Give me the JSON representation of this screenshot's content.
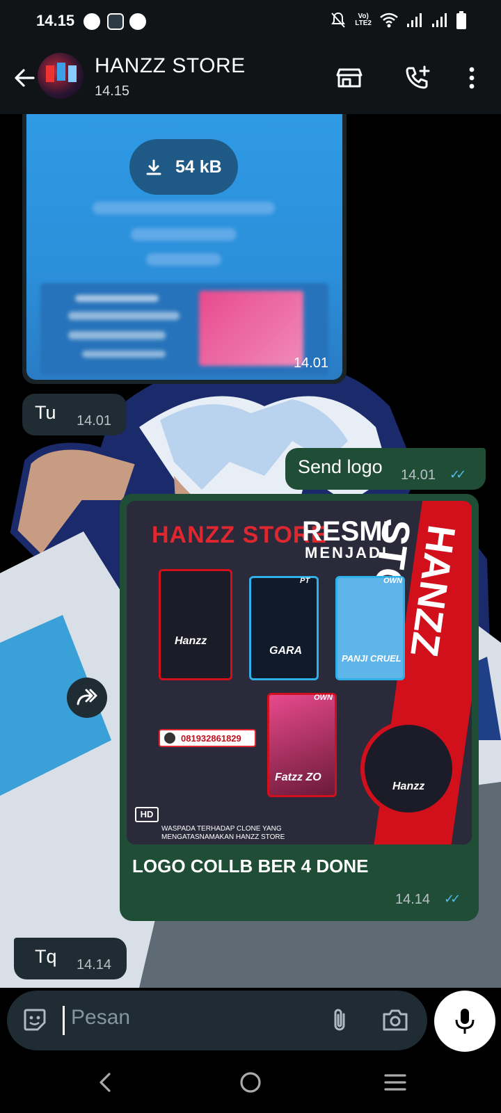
{
  "status_bar": {
    "time": "14.15",
    "network_label": "LTE2"
  },
  "header": {
    "title": "HANZZ STORE",
    "subtitle": "14.15"
  },
  "messages": {
    "receipt": {
      "download_size": "54 kB",
      "time": "14.01"
    },
    "tu": {
      "text": "Tu",
      "time": "14.01"
    },
    "send_logo": {
      "text": "Send logo",
      "time": "14.01"
    },
    "logo_post": {
      "image_title": "HANZZ STORE",
      "image_resmi": "RESMI",
      "image_menjadi": "MENJADI",
      "card_1_label": "Hanzz",
      "card_2_label": "GARA",
      "card_3_label": "PANJI CRUEL",
      "card_4_label": "Fatzz ZO",
      "circle_label": "Hanzz",
      "tag_pt": "PT",
      "tag_own_1": "OWN",
      "tag_own_2": "OWN",
      "phone": "081932861829",
      "warning": "WASPADA TERHADAP CLONE YANG MENGATASNAMAKAN HANZZ STORE",
      "hd_badge": "HD",
      "band_text": "HANZZ STORE",
      "caption": "LOGO COLLB BER 4 DONE",
      "time": "14.14"
    },
    "tq": {
      "text": "Tq",
      "time": "14.14"
    }
  },
  "composer": {
    "placeholder": "Pesan"
  },
  "colors": {
    "bar_bg": "#111416",
    "incoming_bubble": "#202c33",
    "outgoing_bubble": "#1f4d36",
    "read_ticks": "#53bdeb",
    "brand_red": "#e0262e"
  }
}
